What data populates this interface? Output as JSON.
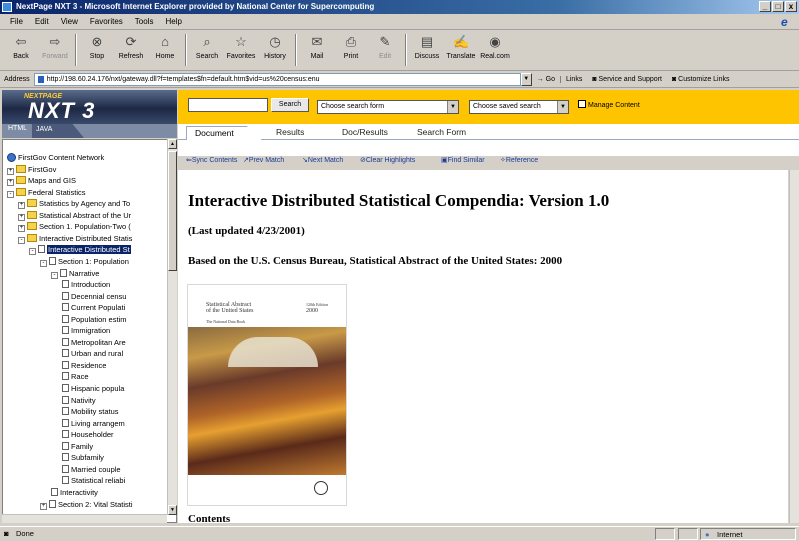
{
  "window": {
    "title": "NextPage NXT 3 - Microsoft Internet Explorer provided by National Center for Supercomputing",
    "controls": [
      "_",
      "□",
      "x"
    ]
  },
  "menu": [
    "File",
    "Edit",
    "View",
    "Favorites",
    "Tools",
    "Help"
  ],
  "toolbar": [
    {
      "label": "Back",
      "icon": "back-arrow-icon",
      "glyph": "⇦",
      "disabled": false
    },
    {
      "label": "Forward",
      "icon": "forward-arrow-icon",
      "glyph": "⇨",
      "disabled": true
    },
    {
      "label": "Stop",
      "icon": "stop-icon",
      "glyph": "⊗",
      "disabled": false
    },
    {
      "label": "Refresh",
      "icon": "refresh-icon",
      "glyph": "⟳",
      "disabled": false
    },
    {
      "label": "Home",
      "icon": "home-icon",
      "glyph": "⌂",
      "disabled": false
    },
    {
      "label": "Search",
      "icon": "search-icon",
      "glyph": "⌕",
      "disabled": false
    },
    {
      "label": "Favorites",
      "icon": "favorites-icon",
      "glyph": "☆",
      "disabled": false
    },
    {
      "label": "History",
      "icon": "history-icon",
      "glyph": "◷",
      "disabled": false
    },
    {
      "label": "Mail",
      "icon": "mail-icon",
      "glyph": "✉",
      "disabled": false
    },
    {
      "label": "Print",
      "icon": "print-icon",
      "glyph": "⎙",
      "disabled": false
    },
    {
      "label": "Edit",
      "icon": "edit-icon",
      "glyph": "✎",
      "disabled": true
    },
    {
      "label": "Discuss",
      "icon": "discuss-icon",
      "glyph": "▤",
      "disabled": false
    },
    {
      "label": "Translate",
      "icon": "translate-icon",
      "glyph": "✍",
      "disabled": false
    },
    {
      "label": "Real.com",
      "icon": "realcom-icon",
      "glyph": "◉",
      "disabled": false
    }
  ],
  "address": {
    "label": "Address",
    "url": "http://198.60.24.176/nxt/gateway.dll?f=templates$fn=default.htm$vid=us%20census:enu",
    "go": "Go",
    "links_label": "Links",
    "links": [
      "Service and Support",
      "Customize Links"
    ]
  },
  "nxt": {
    "logo_small": "NEXTPAGE",
    "logo_big": "NXT 3",
    "search_button": "Search",
    "search_form_select": "Choose search form",
    "saved_search_select": "Choose saved search",
    "manage_content": "Manage Content"
  },
  "left_tabs": [
    "HTML",
    "JAVA"
  ],
  "tree": [
    {
      "label": "FirstGov Content Network",
      "type": "globe",
      "level": 0,
      "exp": ""
    },
    {
      "label": "FirstGov",
      "type": "folder",
      "level": 0,
      "exp": "+"
    },
    {
      "label": "Maps and GIS",
      "type": "folder",
      "level": 0,
      "exp": "+"
    },
    {
      "label": "Federal Statistics",
      "type": "folder",
      "level": 0,
      "exp": "-"
    },
    {
      "label": "Statistics by Agency and To",
      "type": "folder",
      "level": 1,
      "exp": "+"
    },
    {
      "label": "Statistical Abstract of the Ur",
      "type": "folder",
      "level": 1,
      "exp": "+"
    },
    {
      "label": "Section 1. Population-Two (",
      "type": "folder",
      "level": 1,
      "exp": "+"
    },
    {
      "label": "Interactive Distributed Statis",
      "type": "folder",
      "level": 1,
      "exp": "-"
    },
    {
      "label": "Interactive Distributed St",
      "type": "doc",
      "level": 2,
      "exp": "-",
      "selected": true
    },
    {
      "label": "Section 1: Population",
      "type": "doc",
      "level": 3,
      "exp": "-"
    },
    {
      "label": "Narrative",
      "type": "doc",
      "level": 4,
      "exp": "-"
    },
    {
      "label": "Introduction",
      "type": "doc",
      "level": 5,
      "exp": ""
    },
    {
      "label": "Decennial censu",
      "type": "doc",
      "level": 5,
      "exp": ""
    },
    {
      "label": "Current Populati",
      "type": "doc",
      "level": 5,
      "exp": ""
    },
    {
      "label": "Population estim",
      "type": "doc",
      "level": 5,
      "exp": ""
    },
    {
      "label": "Immigration",
      "type": "doc",
      "level": 5,
      "exp": ""
    },
    {
      "label": "Metropolitan Are",
      "type": "doc",
      "level": 5,
      "exp": ""
    },
    {
      "label": "Urban and rural",
      "type": "doc",
      "level": 5,
      "exp": ""
    },
    {
      "label": "Residence",
      "type": "doc",
      "level": 5,
      "exp": ""
    },
    {
      "label": "Race",
      "type": "doc",
      "level": 5,
      "exp": ""
    },
    {
      "label": "Hispanic popula",
      "type": "doc",
      "level": 5,
      "exp": ""
    },
    {
      "label": "Nativity",
      "type": "doc",
      "level": 5,
      "exp": ""
    },
    {
      "label": "Mobility status",
      "type": "doc",
      "level": 5,
      "exp": ""
    },
    {
      "label": "Living arrangem",
      "type": "doc",
      "level": 5,
      "exp": ""
    },
    {
      "label": "Householder",
      "type": "doc",
      "level": 5,
      "exp": ""
    },
    {
      "label": "Family",
      "type": "doc",
      "level": 5,
      "exp": ""
    },
    {
      "label": "Subfamily",
      "type": "doc",
      "level": 5,
      "exp": ""
    },
    {
      "label": "Married couple",
      "type": "doc",
      "level": 5,
      "exp": ""
    },
    {
      "label": "Statistical reliabi",
      "type": "doc",
      "level": 5,
      "exp": ""
    },
    {
      "label": "Interactivity",
      "type": "doc",
      "level": 4,
      "exp": ""
    },
    {
      "label": "Section 2: Vital Statisti",
      "type": "doc",
      "level": 3,
      "exp": "+"
    }
  ],
  "content_tabs": [
    "Document",
    "Results",
    "Doc/Results",
    "Search Form"
  ],
  "content_tools": [
    {
      "label": "Sync Contents",
      "icon": "sync-icon",
      "glyph": "⇐"
    },
    {
      "label": "Prev Match",
      "icon": "prev-match-icon",
      "glyph": "↗"
    },
    {
      "label": "Next Match",
      "icon": "next-match-icon",
      "glyph": "↘"
    },
    {
      "label": "Clear Highlights",
      "icon": "clear-highlights-icon",
      "glyph": "⊘"
    },
    {
      "label": "Find Similar",
      "icon": "find-similar-icon",
      "glyph": "▣"
    },
    {
      "label": "Reference",
      "icon": "reference-icon",
      "glyph": "✧"
    }
  ],
  "document": {
    "title": "Interactive Distributed Statistical Compendia: Version 1.0",
    "updated": "(Last updated 4/23/2001)",
    "based_on": "Based on the U.S. Census Bureau, Statistical Abstract of the United States: 2000",
    "cover_title_1": "Statistical Abstract",
    "cover_title_2": "of the United States",
    "cover_subtitle": "The National Data Book",
    "cover_year_1": "120th Edition",
    "cover_year_2": "2000",
    "contents_heading": "Contents"
  },
  "status": {
    "text": "Done",
    "zone": "Internet"
  }
}
